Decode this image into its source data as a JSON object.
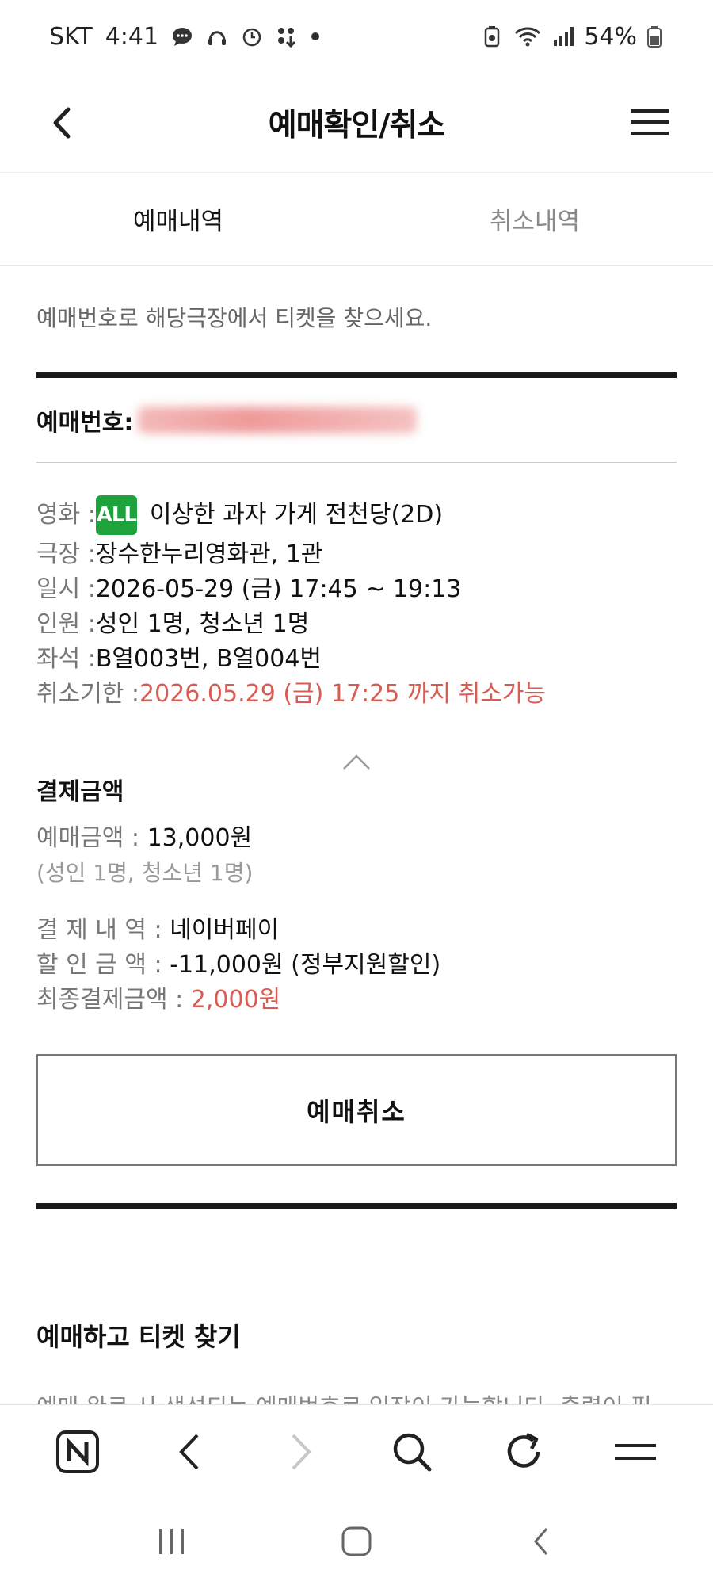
{
  "status_bar": {
    "carrier": "SKT",
    "time": "4:41",
    "battery": "54%"
  },
  "header": {
    "title": "예매확인/취소"
  },
  "tabs": [
    {
      "label": "예매내역",
      "active": true
    },
    {
      "label": "취소내역",
      "active": false
    }
  ],
  "guide_text": "예매번호로 해당극장에서 티켓을 찾으세요.",
  "reservation": {
    "number_label": "예매번호:",
    "movie_label": "영화 : ",
    "rating_badge": "ALL",
    "movie_title": "이상한 과자 가게 전천당(2D)",
    "theater_label": "극장 : ",
    "theater": "장수한누리영화관, 1관",
    "datetime_label": "일시 : ",
    "datetime": "2026-05-29 (금) 17:45 ~ 19:13",
    "people_label": "인원 : ",
    "people": "성인 1명, 청소년 1명",
    "seats_label": "좌석 : ",
    "seats": "B열003번, B열004번",
    "cancel_deadline_label": "취소기한 : ",
    "cancel_deadline": "2026.05.29 (금) 17:25 까지 취소가능"
  },
  "payment": {
    "title": "결제금액",
    "amount_label": "예매금액 : ",
    "amount": "13,000원",
    "amount_detail": "(성인 1명, 청소년 1명)",
    "method_label": "결 제 내 역 : ",
    "method": "네이버페이",
    "discount_label": "할 인 금 액 : ",
    "discount": "-11,000원 (정부지원할인)",
    "final_label": "최종결제금액 : ",
    "final": "2,000원"
  },
  "cancel_button": "예매취소",
  "find_ticket": {
    "title": "예매하고 티켓 찾기",
    "text": "예매 완료 시 생성되는 예매번호로 입장이 가능합니다. 출력이 필"
  },
  "colors": {
    "accent_red": "#d85c52",
    "rating_green": "#1ea33c"
  }
}
